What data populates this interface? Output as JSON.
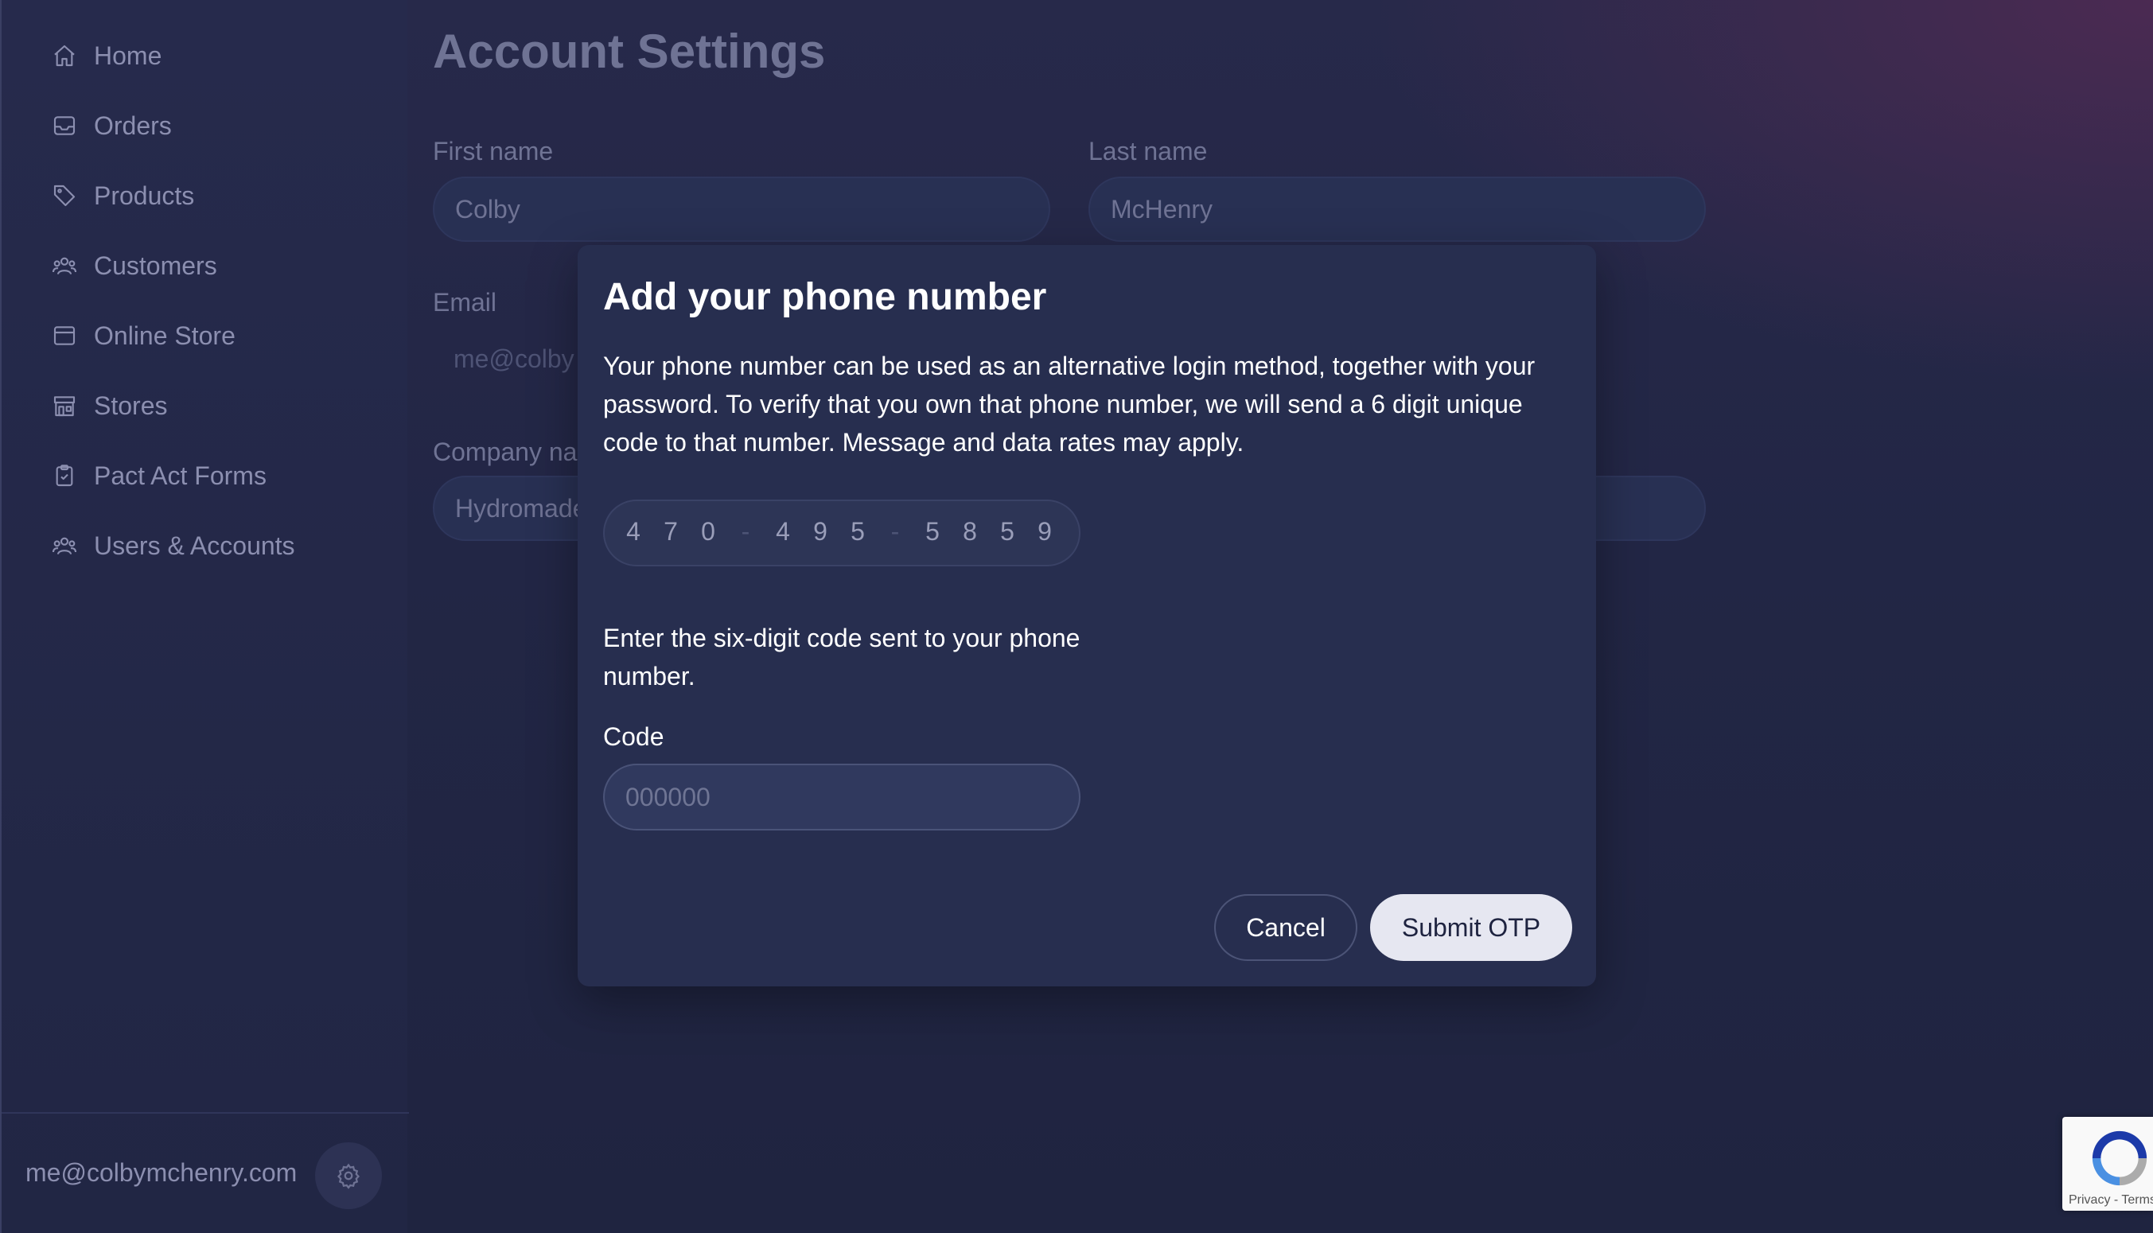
{
  "sidebar": {
    "items": [
      {
        "label": "Home",
        "icon": "home-icon"
      },
      {
        "label": "Orders",
        "icon": "inbox-icon"
      },
      {
        "label": "Products",
        "icon": "tag-icon"
      },
      {
        "label": "Customers",
        "icon": "users-icon"
      },
      {
        "label": "Online Store",
        "icon": "browser-icon"
      },
      {
        "label": "Stores",
        "icon": "storefront-icon"
      },
      {
        "label": "Pact Act Forms",
        "icon": "clipboard-icon"
      },
      {
        "label": "Users & Accounts",
        "icon": "users-icon"
      }
    ],
    "footer": {
      "email": "me@colbymchenry.com",
      "settings_icon": "gear-icon"
    }
  },
  "main": {
    "title": "Account Settings",
    "fields": {
      "first_name": {
        "label": "First name",
        "value": "Colby"
      },
      "last_name": {
        "label": "Last name",
        "value": "McHenry"
      },
      "email": {
        "label": "Email",
        "value": "me@colbymchenry.com"
      },
      "company": {
        "label": "Company name",
        "value": "Hydromade"
      }
    }
  },
  "modal": {
    "title": "Add your phone number",
    "description": "Your phone number can be used as an alternative login method, together with your password. To verify that you own that phone number, we will send a 6 digit unique code to that number. Message and data rates may apply.",
    "phone_digits": [
      "4",
      "7",
      "0",
      "4",
      "9",
      "5",
      "5",
      "8",
      "5",
      "9"
    ],
    "phone_separator": "-",
    "code_hint": "Enter the six-digit code sent to your phone number.",
    "code_label": "Code",
    "code_placeholder": "000000",
    "cancel_label": "Cancel",
    "submit_label": "Submit OTP"
  },
  "recaptcha": {
    "links": "Privacy - Terms"
  },
  "colors": {
    "background": "#222645",
    "modal": "#272e4f",
    "submit_button": "#e6e7f1",
    "muted_text": "#8c8fb0"
  }
}
